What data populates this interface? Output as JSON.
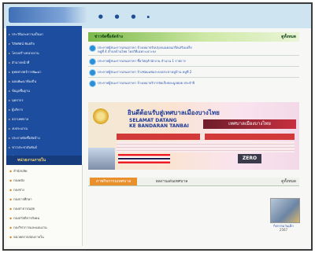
{
  "header": {
    "logo_text": "",
    "dots": "• • •  ·"
  },
  "sidebar": {
    "menu_items": [
      "ประวัติและความเป็นมา",
      "วิสัยทัศน์ พันธกิจ",
      "โครงสร้างหน่วยงาน",
      "อำนาจหน้าที่",
      "ยุทธศาสตร์การพัฒนา",
      "แผนพัฒนาท้องถิ่น",
      "ข้อมูลพื้นฐาน",
      "บุคลากร",
      "ผู้บริหาร",
      "สภาเทศบาล",
      "งบประมาณ",
      "ประกาศจัดซื้อจัดจ้าง",
      "ข่าวประชาสัมพันธ์",
      "กิจกรรม",
      "ติดต่อเรา"
    ],
    "section_title": "หน่วยงานภายใน",
    "list": [
      "สำนักปลัด",
      "กองคลัง",
      "กองช่าง",
      "กองการศึกษา",
      "กองสาธารณสุข",
      "กองสวัสดิการสังคม",
      "กองวิชาการและแผนงาน",
      "หน่วยตรวจสอบภายใน"
    ]
  },
  "news": {
    "title": "ข่าวจัดซื้อจัดจ้าง",
    "view_all": "ดูทั้งหมด",
    "items": [
      {
        "line1": "ประกาศผู้ชนะการเสนอราคา จ้างเหมาปรับปรุงถนนคอนกรีตเสริมเหล็ก",
        "line2": "หมู่ที่ 4 ตำบลบ้านไทย โดยวิธีเฉพาะเจาะจง"
      },
      {
        "line1": "ประกาศผู้ชนะการเสนอราคา ซื้อวัสดุสำนักงาน จำนวน 1 รายการ",
        "line2": ""
      },
      {
        "line1": "ประกาศผู้ชนะการเสนอราคา จ้างซ่อมแซมระบบประปาหมู่บ้าน หมู่ที่ 2",
        "line2": ""
      },
      {
        "line1": "ประกาศผู้ชนะการเสนอราคา จ้างเหมาบริการจัดเก็บขยะมูลฝอย ประจำปี",
        "line2": ""
      }
    ]
  },
  "banner": {
    "title": "ยินดีต้อนรับสู่เทศบาลเมืองบางไทย",
    "subtitle_1": "SELAMAT DATANG",
    "subtitle_2": "KE BANDARAN TANBAI",
    "ribbon": "เทศบาลเมืองบางไทย",
    "zero": "ZERO"
  },
  "activity": {
    "tab_active": "ภาพกิจกรรมเทศบาล",
    "tab_other": "ผลงานเด่นเทศบาล",
    "view_all": "ดูทั้งหมด",
    "thumb_caption": "กิจกรรมวันเด็ก",
    "thumb_date": "2567"
  }
}
